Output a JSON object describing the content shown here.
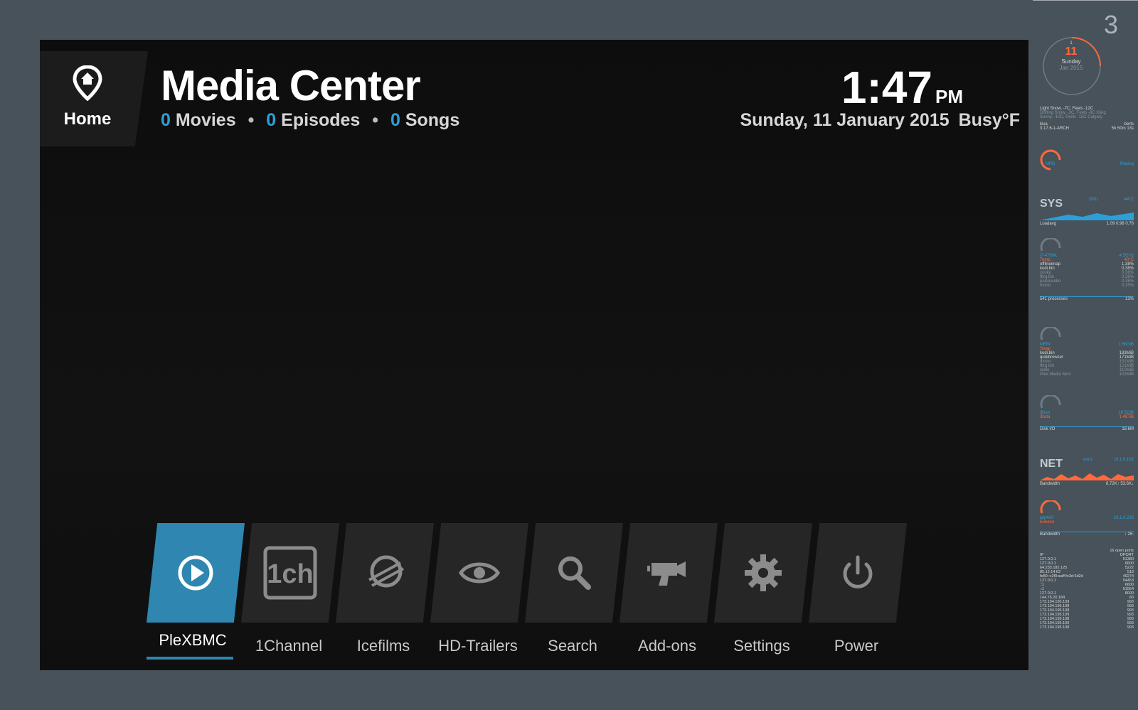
{
  "header": {
    "home_label": "Home",
    "title": "Media Center",
    "counts": [
      {
        "value": "0",
        "label": "Movies"
      },
      {
        "value": "0",
        "label": "Episodes"
      },
      {
        "value": "0",
        "label": "Songs"
      }
    ],
    "time": "1:47",
    "ampm": "PM",
    "date": "Sunday, 11 January 2015",
    "weather": "Busy°F"
  },
  "menu": {
    "items": [
      {
        "label": "PleXBMC",
        "icon": "play-icon",
        "active": true
      },
      {
        "label": "1Channel",
        "icon": "1ch-icon",
        "active": false
      },
      {
        "label": "Icefilms",
        "icon": "icefilms-icon",
        "active": false
      },
      {
        "label": "HD-Trailers",
        "icon": "eye-icon",
        "active": false
      },
      {
        "label": "Search",
        "icon": "search-icon",
        "active": false
      },
      {
        "label": "Add-ons",
        "icon": "addons-icon",
        "active": false
      },
      {
        "label": "Settings",
        "icon": "gear-icon",
        "active": false
      },
      {
        "label": "Power",
        "icon": "power-icon",
        "active": false
      }
    ],
    "one_ch_text": "1ch"
  },
  "conky": {
    "day_number_big": "3",
    "cal_one": "1",
    "cal_day": "11",
    "cal_weekday": "Sunday",
    "cal_month_year": "Jan 2015",
    "weather1": "Light Snow, -7C, Feels -12C",
    "weather2": "Drifting Snow, -3C, Feels -8C Kiing",
    "weather3": "Sunny, -10C, Feels -15C   Calgary",
    "host_left": "kiva",
    "host_right": "berts",
    "kernel": "3.17.6-1-ARCH",
    "uptime": "5h 50m 13s",
    "mpd": "MPD",
    "playing": "Playing",
    "sys_label": "SYS",
    "gpu_label": "GPU",
    "gpu_temp": "44°C",
    "loadavg_label": "Loadavg",
    "loadavg_vals": "1.09  0.98  0.76",
    "cpu_label": "i7-4790K",
    "cpu_freq": "4.5GHz",
    "temp_label": "Temp",
    "temp_val": "40°C",
    "cpu_procs": [
      {
        "name": "offlineimap",
        "val": "1.38%"
      },
      {
        "name": "kodi.bin",
        "val": "0.38%"
      },
      {
        "name": "conky",
        "val": "0.38%"
      },
      {
        "name": "fbrg.bin",
        "val": "0.38%"
      },
      {
        "name": "pulseaudio",
        "val": "0.38%"
      },
      {
        "name": "mono",
        "val": "0.25%"
      }
    ],
    "processes": "541 processes",
    "proc_pct": "13%",
    "mem_label": "MEM",
    "mem_val": "1.56GiB",
    "swap_label": "Swap",
    "mem_procs": [
      {
        "name": "kodi.bin",
        "val": "183MiB"
      },
      {
        "name": "qutebrowser",
        "val": "171MiB"
      },
      {
        "name": "mono",
        "val": "151MiB"
      },
      {
        "name": "fbrg.bin",
        "val": "121MiB"
      },
      {
        "name": "radio",
        "val": "110MiB"
      },
      {
        "name": "Plex Media Serv",
        "val": "102MiB"
      }
    ],
    "boot_label": "/Boot",
    "boot_val": "16.5GiB",
    "data_label": "/Data",
    "data_val": "1.48TiB",
    "diskio_label": "Disk I/O",
    "diskio_val": "18.6M",
    "net_label": "NET",
    "eno_label": "eno1",
    "eno_ip": "10.1.0.101",
    "bandwidth_label": "Bandwidth",
    "bandwidth_vals": "8.72K↑  53.6K↓",
    "wlp_label": "wlp4s0",
    "wlp_ip": "10.1.0.233",
    "wlp_sub": "Exeeco",
    "bandwidth2_vals": "↓  26.",
    "ports_title": "16 open ports",
    "ports_head_ip": "IP",
    "ports_head_port": "DPORT",
    "ports": [
      {
        "ip": "127.0.0.1",
        "port": "51380"
      },
      {
        "ip": "127.0.0.1",
        "port": "6600"
      },
      {
        "ip": "64.233.182.125",
        "port": "5222"
      },
      {
        "ip": "85.12.14.62",
        "port": "518"
      },
      {
        "ip": "fe80::c2f0:aaff:fe3d:5d2d",
        "port": "49274"
      },
      {
        "ip": "127.0.0.1",
        "port": "54453"
      },
      {
        "ip": "::1",
        "port": "6600"
      },
      {
        "ip": "::1",
        "port": "51554"
      },
      {
        "ip": "127.0.0.1",
        "port": "8000"
      },
      {
        "ip": "144.76.20.184",
        "port": "80"
      },
      {
        "ip": "173.194.195.109",
        "port": "993"
      },
      {
        "ip": "173.194.195.108",
        "port": "993"
      },
      {
        "ip": "173.194.195.108",
        "port": "993"
      },
      {
        "ip": "173.194.195.109",
        "port": "993"
      },
      {
        "ip": "173.194.195.108",
        "port": "993"
      },
      {
        "ip": "173.194.195.109",
        "port": "993"
      },
      {
        "ip": "173.194.195.108",
        "port": "993"
      }
    ]
  },
  "colors": {
    "accent": "#2f86b0",
    "count_blue": "#2d9fd8",
    "conky_orange": "#ff6a3d",
    "background": "#47525a"
  }
}
